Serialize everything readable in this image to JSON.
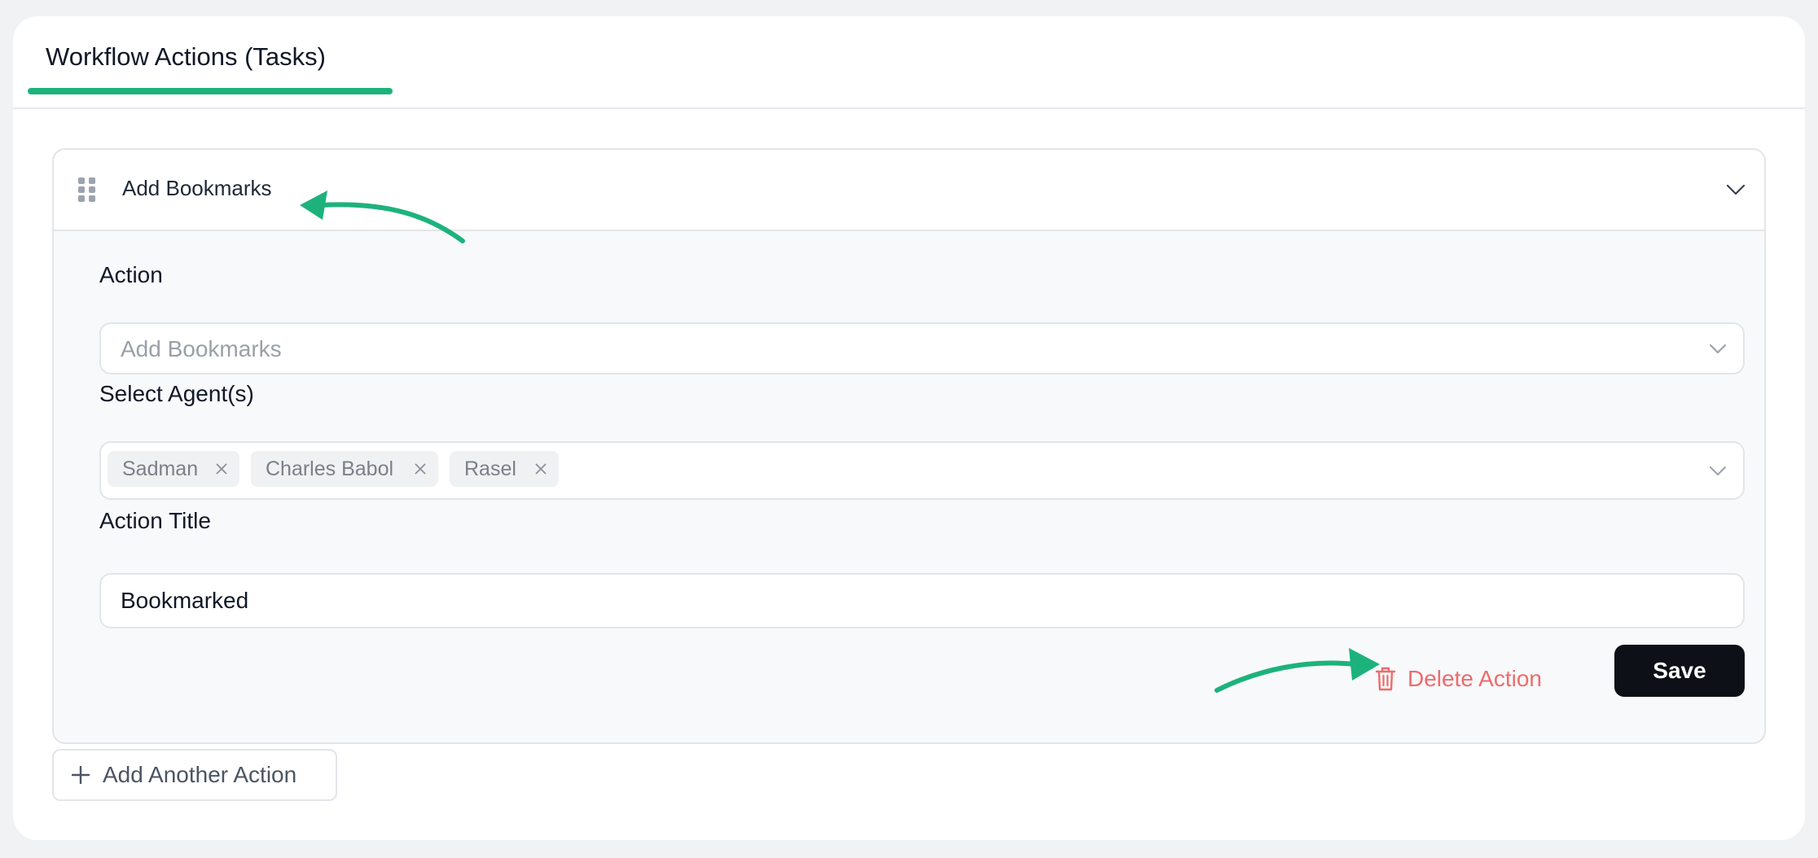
{
  "tabs": [
    {
      "label": "Workflow Actions (Tasks)",
      "active": true
    }
  ],
  "action_card": {
    "header_title": "Add Bookmarks",
    "expanded": true,
    "fields": {
      "action": {
        "label": "Action",
        "value": "Add Bookmarks"
      },
      "agents": {
        "label": "Select Agent(s)",
        "selected": [
          "Sadman",
          "Charles Babol",
          "Rasel"
        ]
      },
      "title": {
        "label": "Action Title",
        "value": "Bookmarked"
      }
    },
    "delete_label": "Delete Action",
    "save_label": "Save"
  },
  "add_action_label": "Add Another Action",
  "icons": {
    "drag": "drag-handle-icon",
    "chevron": "chevron-down-icon",
    "remove": "close-icon",
    "delete": "trash-icon",
    "add": "plus-icon"
  },
  "colors": {
    "accent": "#1db27c",
    "annotation_arrow": "#1db27c",
    "danger": "#ef6b6b",
    "primary_button": "#0d1117"
  }
}
